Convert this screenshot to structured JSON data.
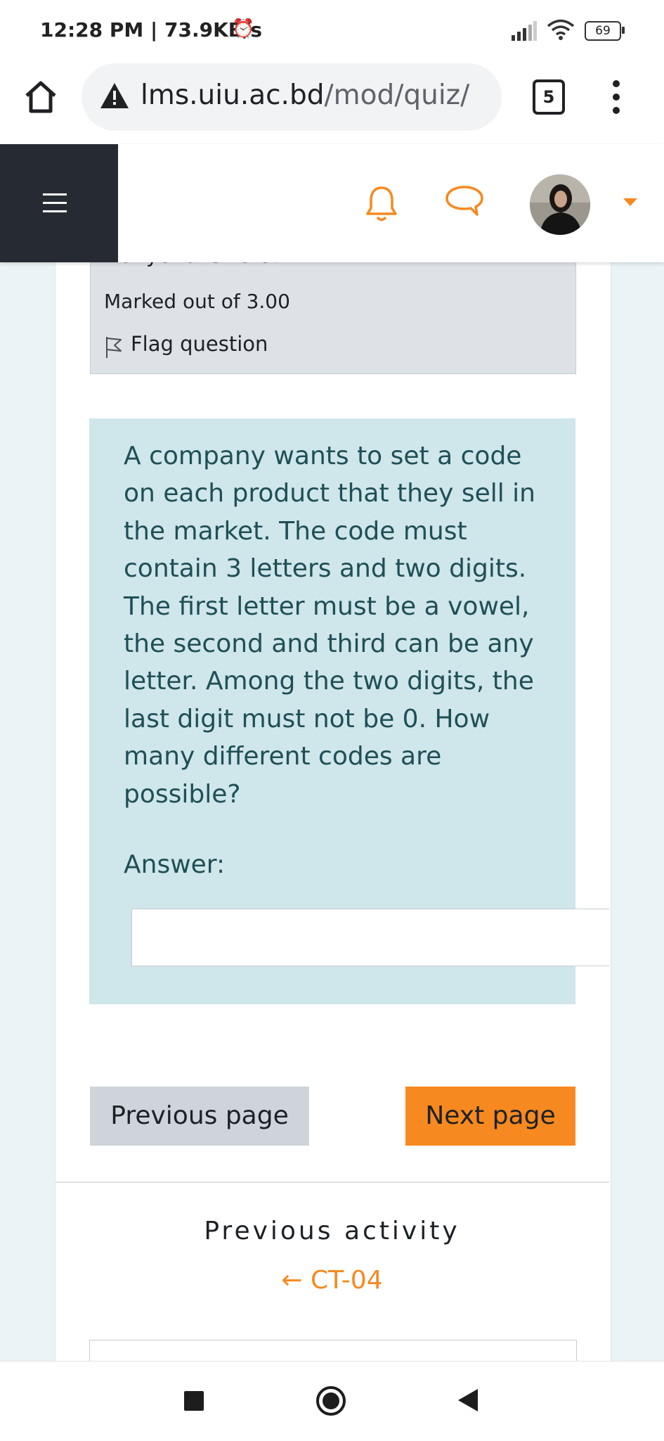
{
  "status_bar": {
    "time_speed": "12:28 PM | 73.9KB/s",
    "alarm_icon": "alarm-clock-icon",
    "battery": "69"
  },
  "browser": {
    "url_host": "lms.uiu.ac.bd",
    "url_path": "/mod/quiz/at",
    "tab_count": "5"
  },
  "question_info": {
    "status_cut": "Not yet answered",
    "marked": "Marked out of 3.00",
    "flag": "Flag question"
  },
  "question": {
    "text": "A company wants to set a code on each product that they sell in the market. The code must contain 3 letters and two digits. The first letter must be a vowel, the second and third can be any letter. Among the two digits, the last digit must not be 0. How many different codes are possible?",
    "answer_label": "Answer:",
    "answer_value": ""
  },
  "navigation": {
    "previous": "Previous page",
    "next": "Next page"
  },
  "activity": {
    "label": "Previous activity",
    "link": "← CT-04"
  },
  "colors": {
    "accent": "#f6891f",
    "question_bg": "#cfe6ea",
    "drawer_bg": "#262b33"
  }
}
